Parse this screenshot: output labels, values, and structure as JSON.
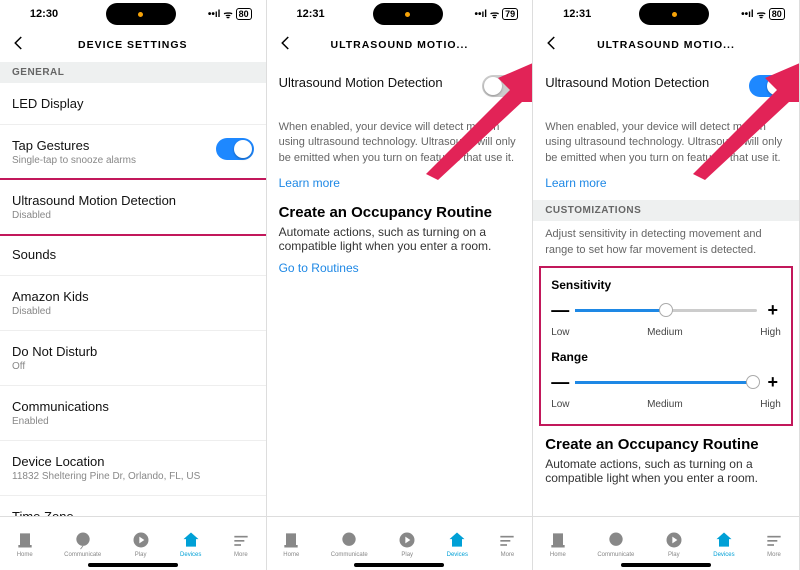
{
  "screens": [
    {
      "statusbar": {
        "time": "12:30",
        "battery": "80"
      },
      "header": "DEVICE SETTINGS",
      "section_general": "GENERAL",
      "rows": {
        "led": {
          "label": "LED Display"
        },
        "tap": {
          "label": "Tap Gestures",
          "sub": "Single-tap to snooze alarms",
          "toggle": true
        },
        "ultra": {
          "label": "Ultrasound Motion Detection",
          "sub": "Disabled"
        },
        "sounds": {
          "label": "Sounds"
        },
        "kids": {
          "label": "Amazon Kids",
          "sub": "Disabled"
        },
        "dnd": {
          "label": "Do Not Disturb",
          "sub": "Off"
        },
        "comm": {
          "label": "Communications",
          "sub": "Enabled"
        },
        "loc": {
          "label": "Device Location",
          "sub": "11832 Sheltering Pine Dr, Orlando, FL, US"
        },
        "tz": {
          "label": "Time Zone"
        }
      }
    },
    {
      "statusbar": {
        "time": "12:31",
        "battery": "79"
      },
      "header": "ULTRASOUND MOTIO...",
      "ultra_label": "Ultrasound Motion Detection",
      "ultra_toggle": false,
      "body": "When enabled, your device will detect motion using ultrasound technology. Ultrasound will only be emitted when you turn on features that use it.",
      "learn_more": "Learn more",
      "occ_title": "Create an Occupancy Routine",
      "occ_body": "Automate actions, such as turning on a compatible light when you enter a room.",
      "routines_link": "Go to Routines"
    },
    {
      "statusbar": {
        "time": "12:31",
        "battery": "80"
      },
      "header": "ULTRASOUND MOTIO...",
      "ultra_label": "Ultrasound Motion Detection",
      "ultra_toggle": true,
      "body": "When enabled, your device will detect motion using ultrasound technology. Ultrasound will only be emitted when you turn on features that use it.",
      "learn_more": "Learn more",
      "section_cust": "CUSTOMIZATIONS",
      "cust_body": "Adjust sensitivity in detecting movement and range to set how far movement is detected.",
      "sliders": {
        "sensitivity": {
          "label": "Sensitivity",
          "left": "Low",
          "mid": "Medium",
          "right": "High",
          "value_percent": 50
        },
        "range": {
          "label": "Range",
          "left": "Low",
          "mid": "Medium",
          "right": "High",
          "value_percent": 98
        }
      },
      "occ_title": "Create an Occupancy Routine",
      "occ_body": "Automate actions, such as turning on a compatible light when you enter a room."
    }
  ],
  "tabs": {
    "home": "Home",
    "comm": "Communicate",
    "play": "Play",
    "devices": "Devices",
    "more": "More"
  }
}
